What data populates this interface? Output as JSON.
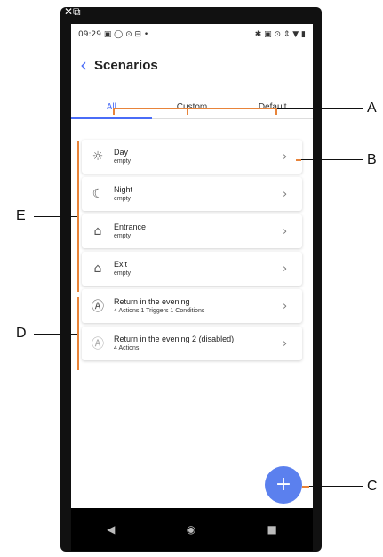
{
  "status_bar": {
    "time": "09:29",
    "left_icons": "▣ ◯ ⊙ ⊟ •",
    "right_icons": "✱ ▣ ⊙ ⇕ ▼ ▮"
  },
  "header": {
    "title": "Scenarios"
  },
  "tabs": [
    {
      "label": "All",
      "active": true
    },
    {
      "label": "Custom",
      "active": false
    },
    {
      "label": "Default",
      "active": false
    }
  ],
  "default_scenarios": [
    {
      "name": "Day",
      "detail": "empty",
      "icon": "sun-icon"
    },
    {
      "name": "Night",
      "detail": "empty",
      "icon": "moon-icon"
    },
    {
      "name": "Entrance",
      "detail": "empty",
      "icon": "entrance-icon"
    },
    {
      "name": "Exit",
      "detail": "empty",
      "icon": "exit-icon"
    }
  ],
  "custom_scenarios": [
    {
      "name": "Return in the evening",
      "detail": "4 Actions 1 Triggers 1 Conditions",
      "icon": "auto-icon"
    },
    {
      "name": "Return in the evening 2 (disabled)",
      "detail": "4 Actions",
      "icon": "auto-icon"
    }
  ],
  "fab": {
    "label": "+"
  },
  "nav": {
    "back": "◀",
    "home": "◉",
    "recent": "■"
  },
  "callouts": {
    "a": "A",
    "b": "B",
    "c": "C",
    "d": "D",
    "e": "E"
  },
  "colors": {
    "accent": "#4a6cf7",
    "fab": "#5b80ee",
    "annotation": "#e8843a"
  }
}
